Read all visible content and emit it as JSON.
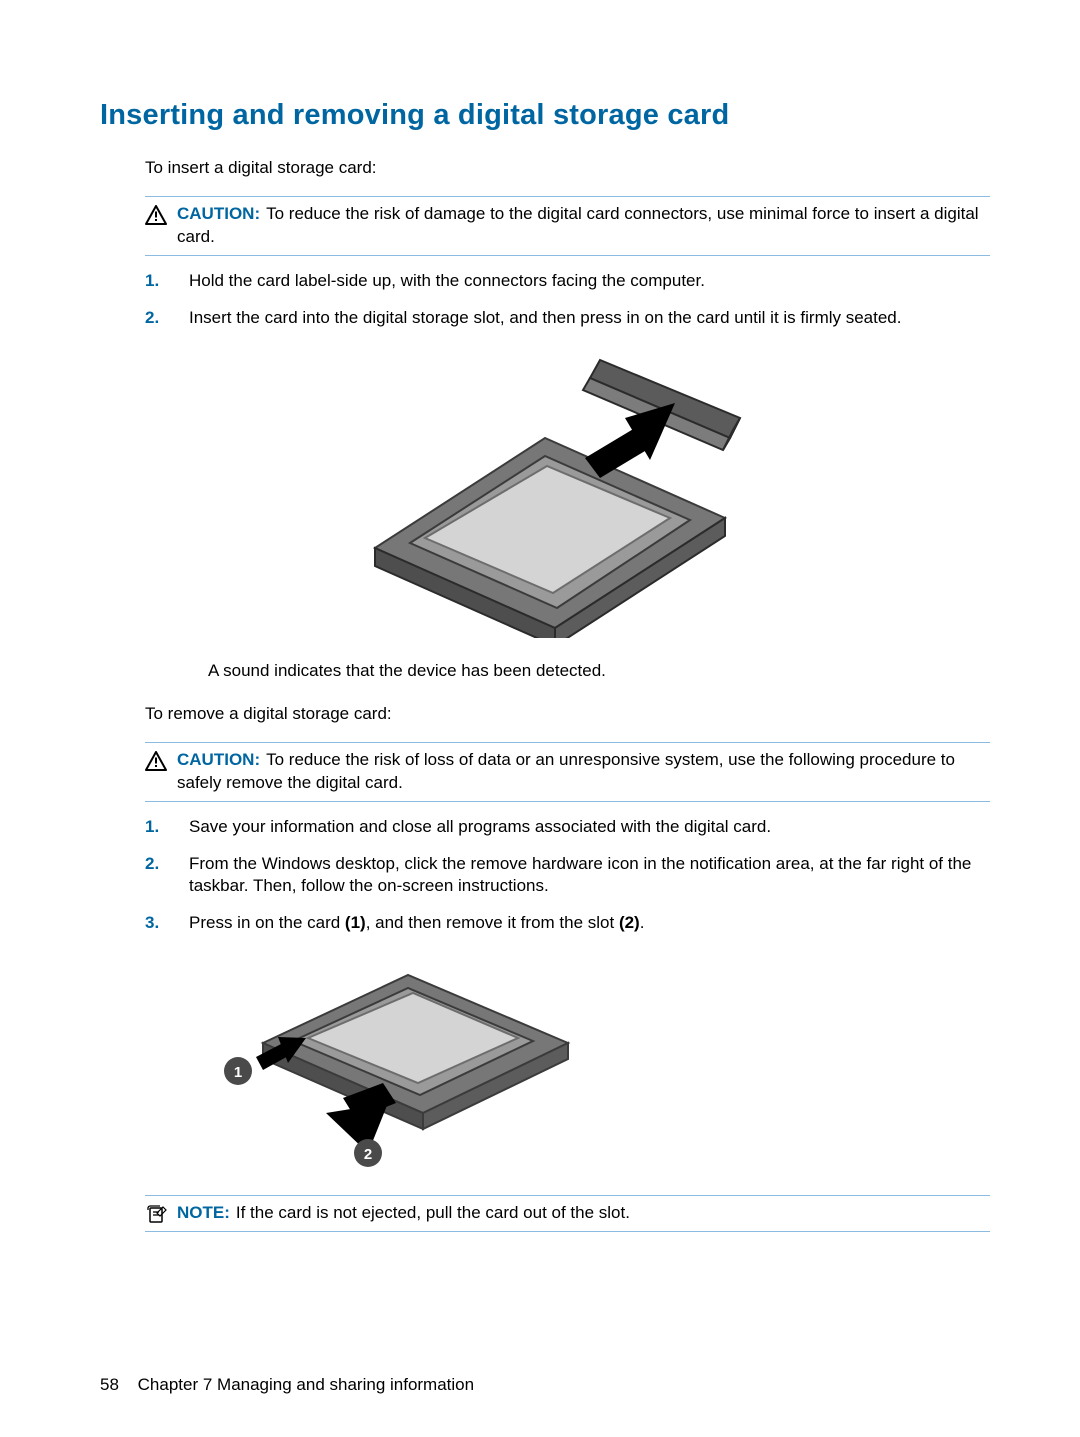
{
  "heading": "Inserting and removing a digital storage card",
  "intro_insert": "To insert a digital storage card:",
  "caution_label": "CAUTION:",
  "caution1_text": "To reduce the risk of damage to the digital card connectors, use minimal force to insert a digital card.",
  "insert_steps": {
    "n1": "1.",
    "s1": "Hold the card label-side up, with the connectors facing the computer.",
    "n2": "2.",
    "s2": "Insert the card into the digital storage slot, and then press in on the card until it is firmly seated."
  },
  "detected_text": "A sound indicates that the device has been detected.",
  "intro_remove": "To remove a digital storage card:",
  "caution2_text": "To reduce the risk of loss of data or an unresponsive system, use the following procedure to safely remove the digital card.",
  "remove_steps": {
    "n1": "1.",
    "s1": "Save your information and close all programs associated with the digital card.",
    "n2": "2.",
    "s2": "From the Windows desktop, click the remove hardware icon in the notification area, at the far right of the taskbar. Then, follow the on-screen instructions.",
    "n3": "3.",
    "s3_pre": "Press in on the card ",
    "s3_b1": "(1)",
    "s3_mid": ", and then remove it from the slot ",
    "s3_b2": "(2)",
    "s3_post": "."
  },
  "note_label": "NOTE:",
  "note_text": "If the card is not ejected, pull the card out of the slot.",
  "footer": {
    "page_number": "58",
    "chapter": "Chapter 7   Managing and sharing information"
  }
}
